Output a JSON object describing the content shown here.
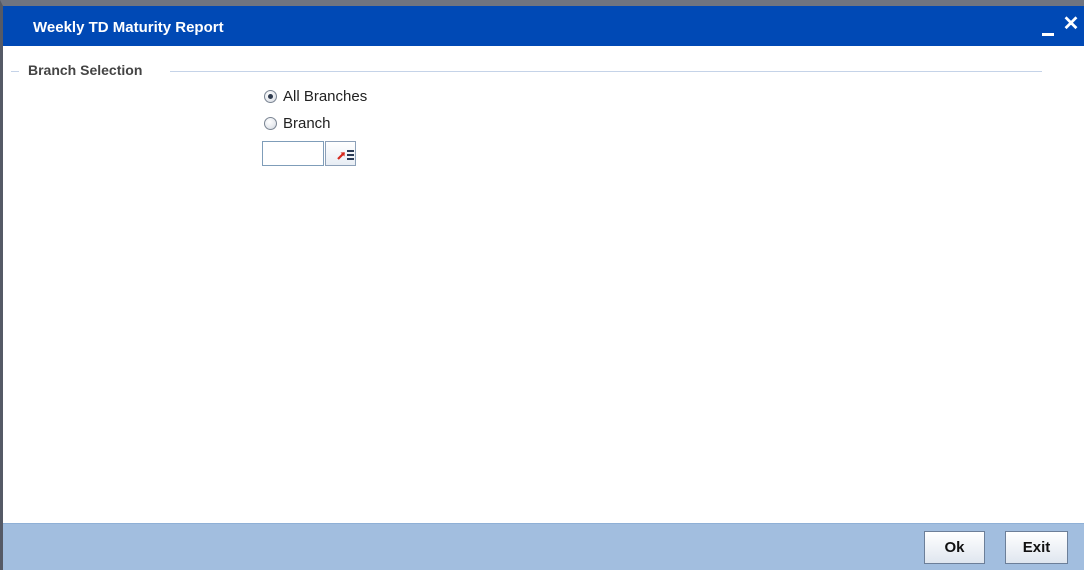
{
  "window": {
    "title": "Weekly TD Maturity Report",
    "minimize_icon": "minimize-icon",
    "close_icon": "close-icon",
    "title_bar_color": "#0049b5"
  },
  "branch_selection": {
    "legend": "Branch Selection",
    "options": [
      {
        "label": "All Branches",
        "selected": true
      },
      {
        "label": "Branch",
        "selected": false
      }
    ],
    "branch_input": {
      "value": "",
      "placeholder": ""
    },
    "lov_icon": "list-of-values-icon"
  },
  "footer": {
    "ok_label": "Ok",
    "exit_label": "Exit",
    "background_color": "#a2bedf"
  }
}
